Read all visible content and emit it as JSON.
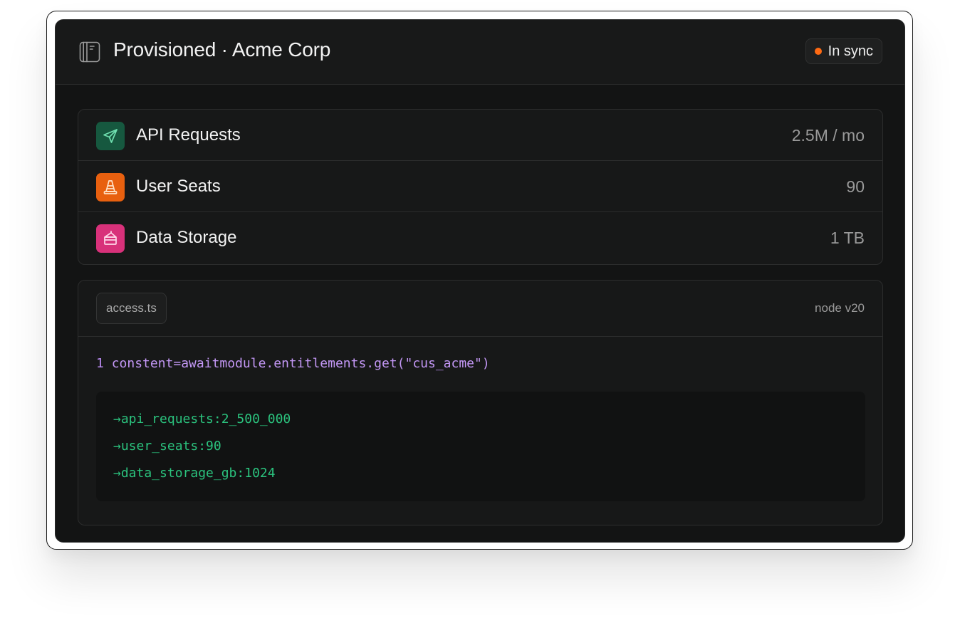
{
  "header": {
    "title": "Provisioned · Acme Corp",
    "status": "In sync",
    "status_color": "#ff6a13",
    "icon": "book-sidebar-icon"
  },
  "entitlements": [
    {
      "label": "API Requests",
      "value": "2.5M / mo",
      "icon": "send-icon",
      "icon_bg": "#16583f",
      "icon_fg": "#6fe0b0"
    },
    {
      "label": "User Seats",
      "value": "90",
      "icon": "traffic-cone-icon",
      "icon_bg": "#e8600f",
      "icon_fg": "#ffe2c8"
    },
    {
      "label": "Data Storage",
      "value": "1 TB",
      "icon": "cake-slice-icon",
      "icon_bg": "#d8317a",
      "icon_fg": "#ffd6e8"
    }
  ],
  "code": {
    "filename": "access.ts",
    "runtime": "node v20",
    "line_number": "1",
    "line": "constent=awaitmodule.entitlements.get(\"cus_acme\")",
    "output": [
      "→api_requests:2_500_000",
      "→user_seats:90",
      "→data_storage_gb:1024"
    ]
  }
}
